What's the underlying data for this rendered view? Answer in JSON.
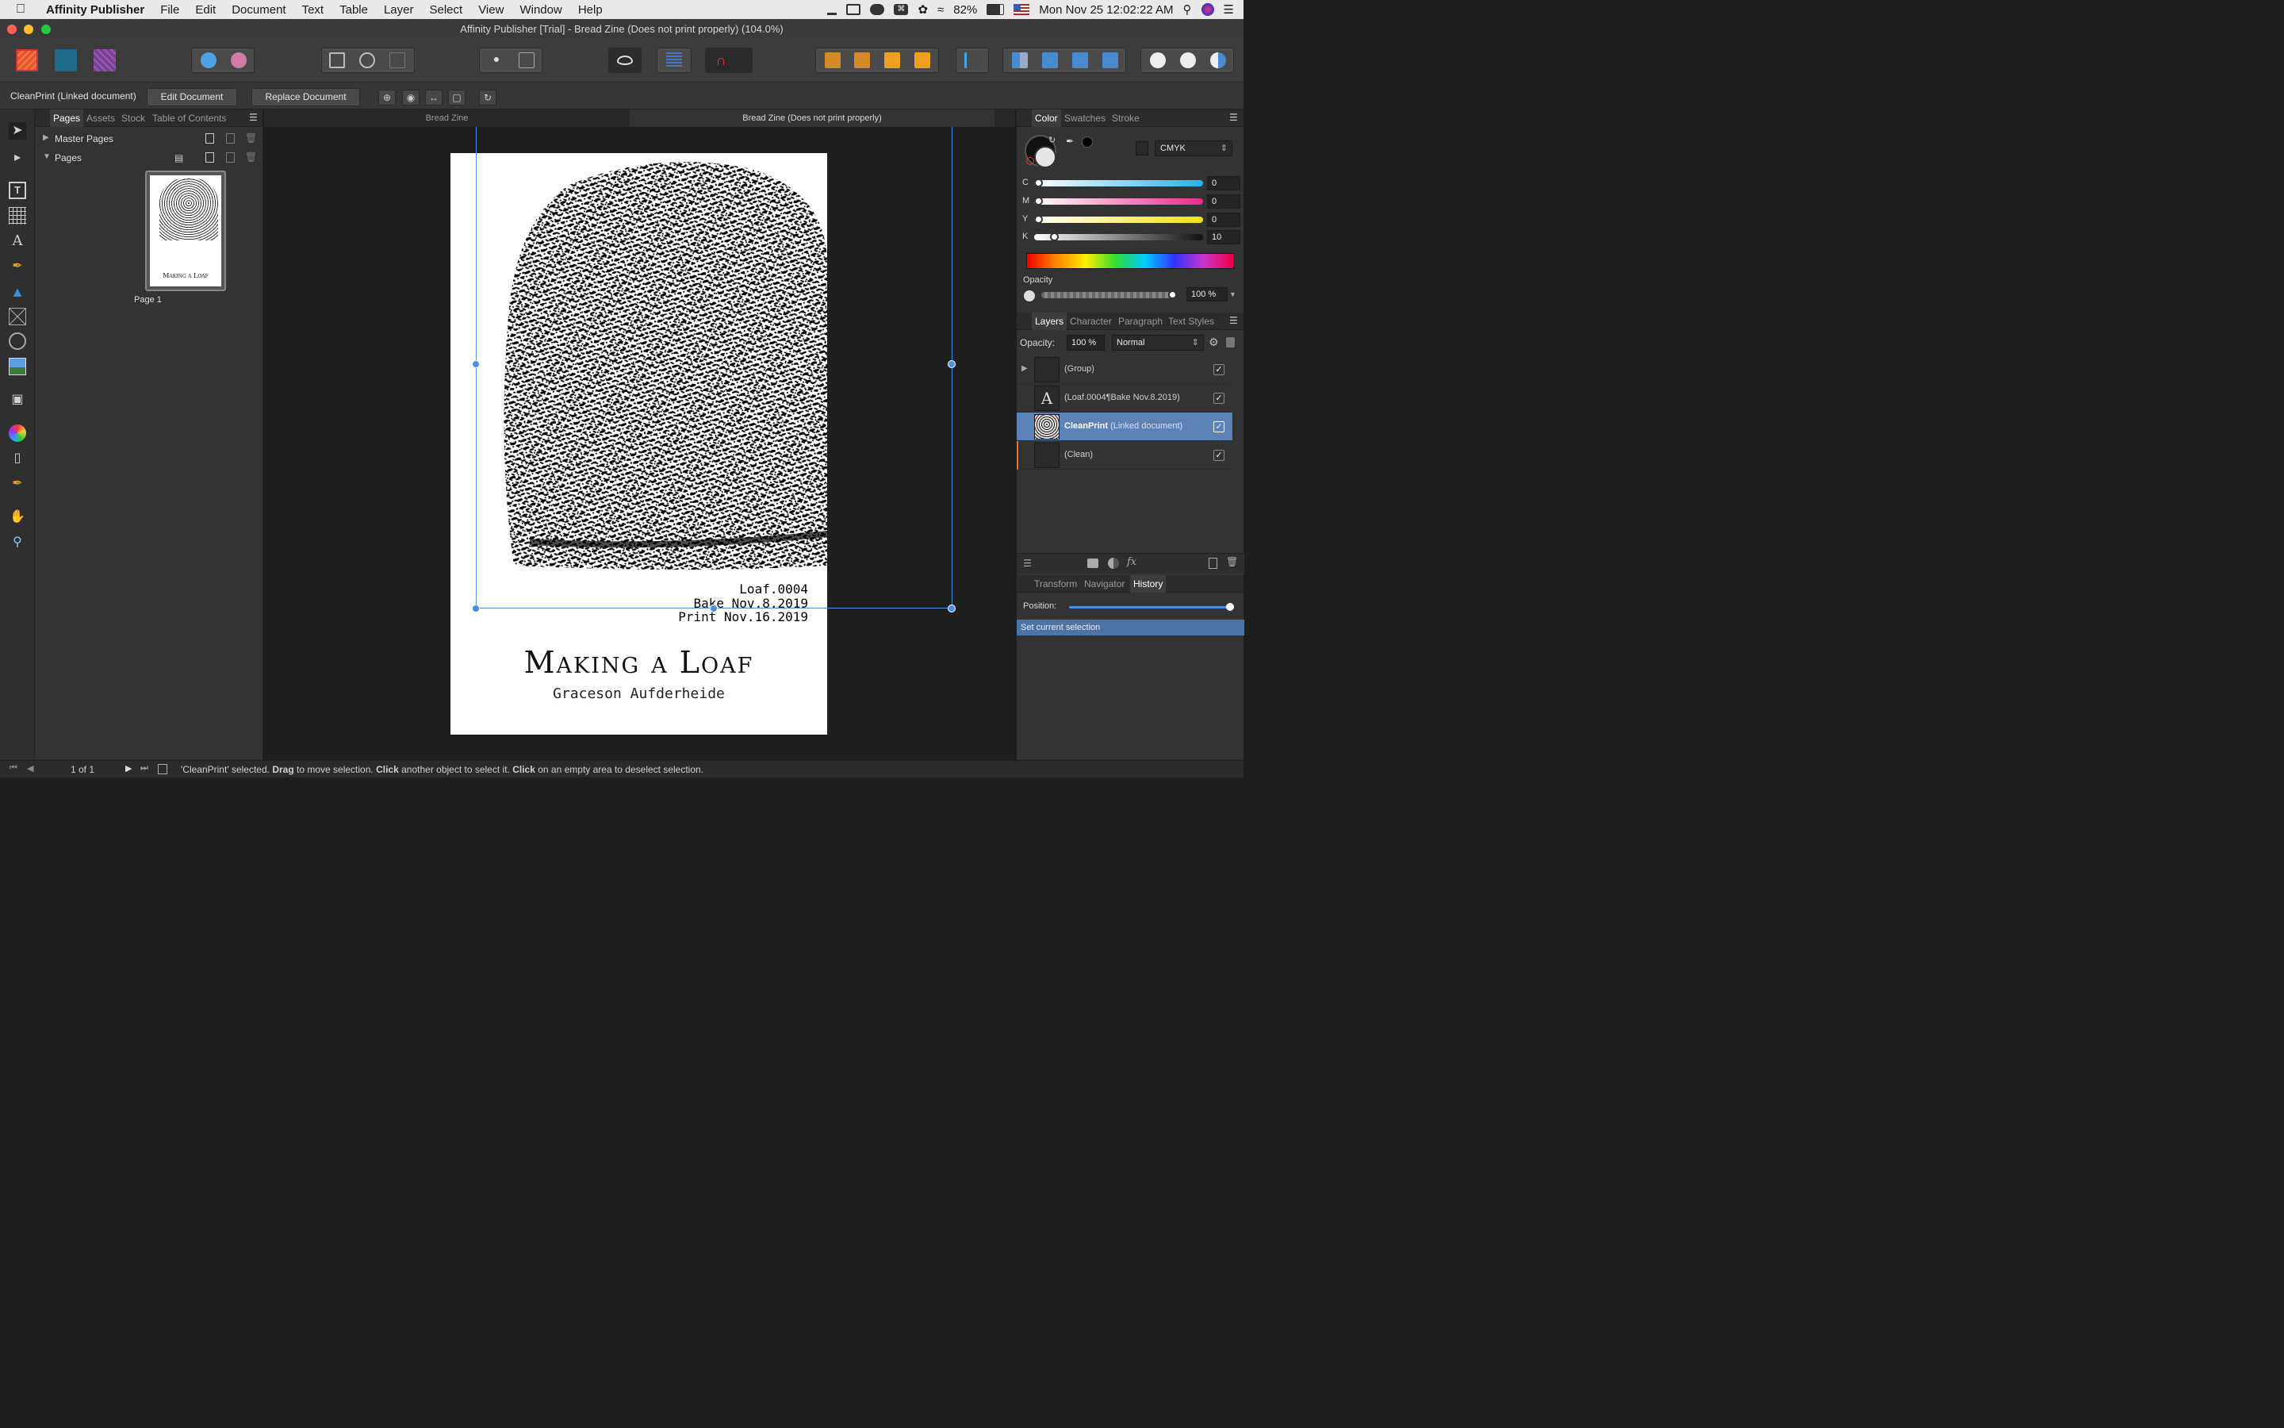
{
  "menubar": {
    "app_name": "Affinity Publisher",
    "items": [
      "File",
      "Edit",
      "Document",
      "Text",
      "Table",
      "Layer",
      "Select",
      "View",
      "Window",
      "Help"
    ],
    "battery": "82%",
    "clock": "Mon Nov 25  12:02:22 AM"
  },
  "window": {
    "title": "Affinity Publisher [Trial] - Bread Zine (Does not print properly) (104.0%)"
  },
  "context_toolbar": {
    "selection_label": "CleanPrint (Linked document)",
    "edit_document": "Edit Document",
    "replace_document": "Replace Document"
  },
  "pages_panel": {
    "tabs": [
      "Pages",
      "Assets",
      "Stock",
      "Table of Contents"
    ],
    "master_pages": "Master Pages",
    "pages": "Pages",
    "page_label": "Page 1"
  },
  "document_tabs": [
    "Bread Zine",
    "Bread Zine (Does not print properly)"
  ],
  "zine": {
    "loaf": "Loaf.0004",
    "bake": "Bake Nov.8.2019",
    "print": "Print Nov.16.2019",
    "title": "Making a Loaf",
    "author": "Graceson Aufderheide"
  },
  "color_panel": {
    "tabs": [
      "Color",
      "Swatches",
      "Stroke"
    ],
    "model": "CMYK",
    "channels": [
      {
        "label": "C",
        "value": "0"
      },
      {
        "label": "M",
        "value": "0"
      },
      {
        "label": "Y",
        "value": "0"
      },
      {
        "label": "K",
        "value": "10"
      }
    ],
    "opacity_label": "Opacity",
    "opacity_value": "100 %"
  },
  "layers_panel": {
    "tabs": [
      "Layers",
      "Character",
      "Paragraph",
      "Text Styles"
    ],
    "opacity_label": "Opacity:",
    "opacity_value": "100 %",
    "blend_mode": "Normal",
    "layers": [
      {
        "name": "(Group)",
        "sub": ""
      },
      {
        "name": "(Loaf.0004¶Bake Nov.8.2019)",
        "sub": ""
      },
      {
        "name": "CleanPrint",
        "sub": "(Linked document)"
      },
      {
        "name": "(Clean)",
        "sub": ""
      }
    ]
  },
  "history_panel": {
    "tabs": [
      "Transform",
      "Navigator",
      "History"
    ],
    "position_label": "Position:",
    "entry": "Set current selection"
  },
  "statusbar": {
    "page_counter": "1 of 1",
    "msg_1": "'CleanPrint' selected.",
    "msg_drag": "Drag",
    "msg_2": "to move selection.",
    "msg_click": "Click",
    "msg_3": "another object to select it.",
    "msg_click2": "Click",
    "msg_4": "on an empty area to deselect selection."
  },
  "colors": {
    "accent": "#4a90e2",
    "selection_row": "#5b83b7",
    "history_row": "#4c74a6"
  }
}
